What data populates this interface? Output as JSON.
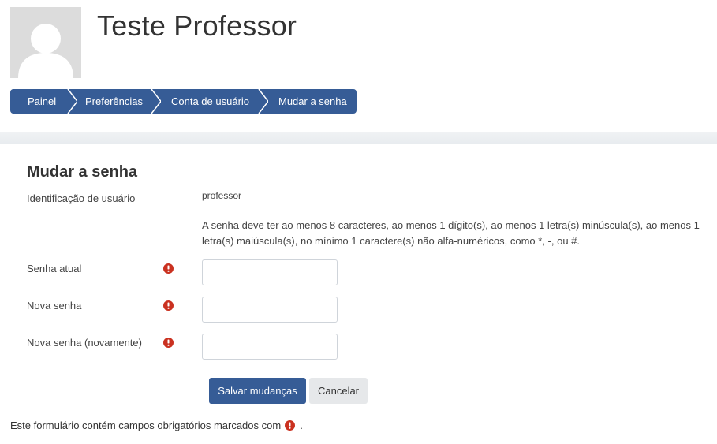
{
  "profile": {
    "name": "Teste Professor",
    "avatar_icon": "user-silhouette-icon"
  },
  "breadcrumb": {
    "items": [
      {
        "label": "Painel"
      },
      {
        "label": "Preferências"
      },
      {
        "label": "Conta de usuário"
      },
      {
        "label": "Mudar a senha"
      }
    ]
  },
  "form": {
    "title": "Mudar a senha",
    "username_label": "Identificação de usuário",
    "username_value": "professor",
    "policy_text": "A senha deve ter ao menos 8 caracteres, ao menos 1 dígito(s), ao menos 1 letra(s) minúscula(s), ao menos 1 letra(s) maiúscula(s), no mínimo 1 caractere(s) não alfa-numéricos, como *, -, ou #.",
    "fields": [
      {
        "label": "Senha atual",
        "value": "",
        "required_icon": "exclamation-circle-icon"
      },
      {
        "label": "Nova senha",
        "value": "",
        "required_icon": "exclamation-circle-icon"
      },
      {
        "label": "Nova senha (novamente)",
        "value": "",
        "required_icon": "exclamation-circle-icon"
      }
    ],
    "save_label": "Salvar mudanças",
    "cancel_label": "Cancelar"
  },
  "footer": {
    "required_note": "Este formulário contém campos obrigatórios marcados com",
    "required_note_end": "."
  },
  "colors": {
    "primary": "#365c96",
    "required": "#ca3120",
    "secondary_button": "#e6e8ea"
  }
}
